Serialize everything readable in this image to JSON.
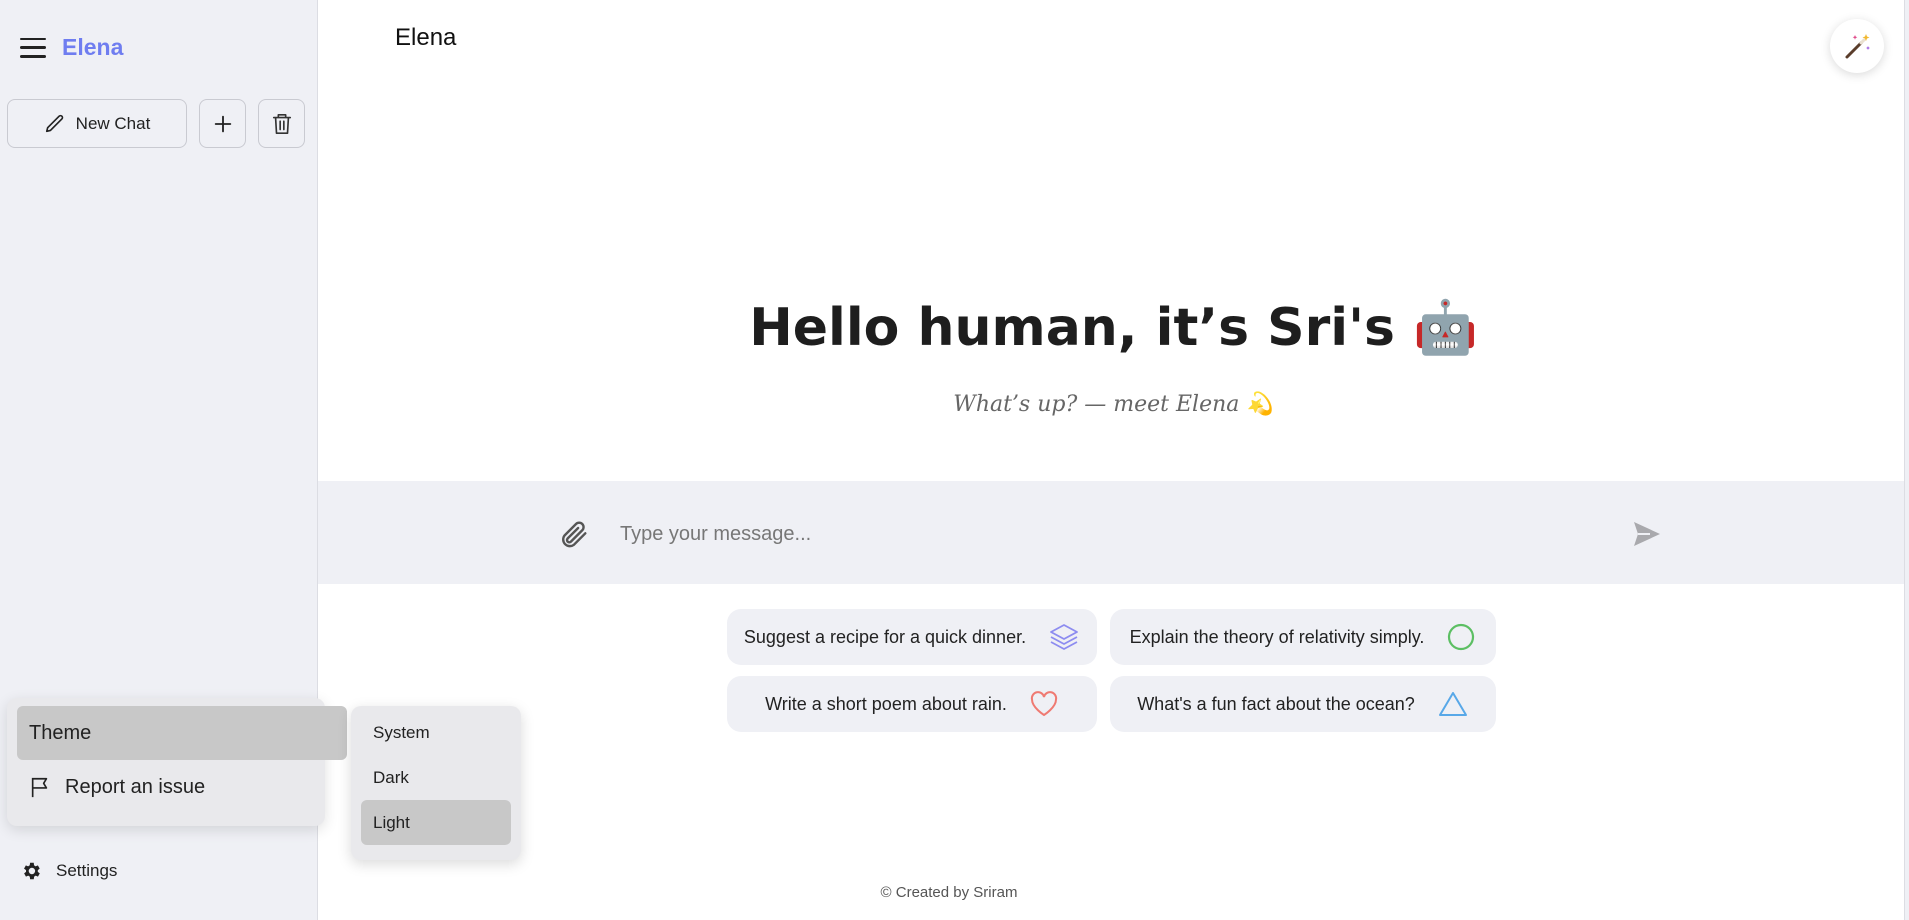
{
  "sidebar": {
    "brand": "Elena",
    "new_chat_label": "New Chat",
    "settings_label": "Settings"
  },
  "settings_menu": {
    "theme_label": "Theme",
    "report_label": "Report an issue",
    "theme_options": [
      "System",
      "Dark",
      "Light"
    ],
    "selected_theme": "Light"
  },
  "header": {
    "title": "Elena"
  },
  "hero": {
    "greeting": "Hello human, it’s Sri's 🤖",
    "subtitle": "What’s up? — meet Elena 💫"
  },
  "composer": {
    "placeholder": "Type your message..."
  },
  "suggestions": [
    {
      "label": "Suggest a recipe for a quick dinner.",
      "icon": "layers-icon",
      "color": "#8d8cf0"
    },
    {
      "label": "Explain the theory of relativity simply.",
      "icon": "circle-icon",
      "color": "#5cbf63"
    },
    {
      "label": "Write a short poem about rain.",
      "icon": "heart-icon",
      "color": "#ef7a72"
    },
    {
      "label": "What's a fun fact about the ocean?",
      "icon": "triangle-icon",
      "color": "#58a8e8"
    }
  ],
  "footer": {
    "text": "© Created by Sriram"
  },
  "colors": {
    "accent": "#6f7df0",
    "sidebar_bg": "#eff0f5",
    "selected_bg": "#c8c8c8"
  }
}
